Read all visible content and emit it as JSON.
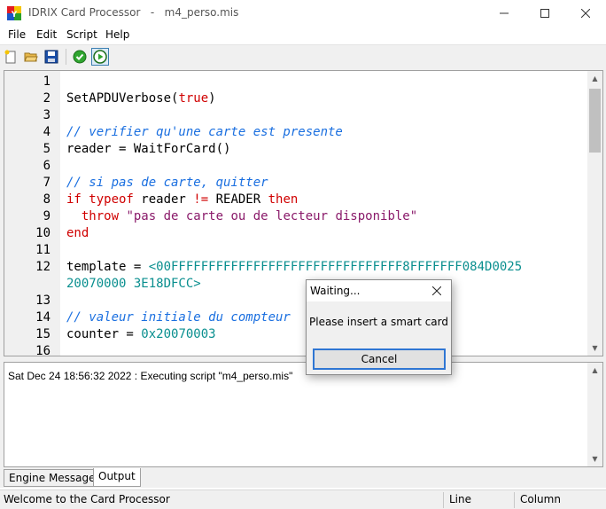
{
  "window": {
    "app_name": "IDRIX Card Processor",
    "separator": "-",
    "file_name": "m4_perso.mis"
  },
  "menu": [
    "File",
    "Edit",
    "Script",
    "Help"
  ],
  "toolbar": {
    "icons": [
      "new-file-icon",
      "open-folder-icon",
      "save-icon",
      "check-icon",
      "run-icon"
    ]
  },
  "editor": {
    "lines": [
      {
        "n": "1",
        "segments": []
      },
      {
        "n": "2",
        "segments": [
          {
            "t": "SetAPDUVerbose(",
            "c": "plain"
          },
          {
            "t": "true",
            "c": "kw"
          },
          {
            "t": ")",
            "c": "plain"
          }
        ]
      },
      {
        "n": "3",
        "segments": []
      },
      {
        "n": "4",
        "segments": [
          {
            "t": "// verifier qu'une carte est presente",
            "c": "cm"
          }
        ]
      },
      {
        "n": "5",
        "segments": [
          {
            "t": "reader = WaitForCard()",
            "c": "plain"
          }
        ]
      },
      {
        "n": "6",
        "segments": []
      },
      {
        "n": "7",
        "segments": [
          {
            "t": "// si pas de carte, quitter",
            "c": "cm"
          }
        ]
      },
      {
        "n": "8",
        "segments": [
          {
            "t": "if typeof",
            "c": "kw"
          },
          {
            "t": " reader ",
            "c": "plain"
          },
          {
            "t": "!=",
            "c": "kw"
          },
          {
            "t": " READER ",
            "c": "plain"
          },
          {
            "t": "then",
            "c": "kw"
          }
        ]
      },
      {
        "n": "9",
        "segments": [
          {
            "t": "  throw ",
            "c": "kw"
          },
          {
            "t": "\"pas de carte ou de lecteur disponible\"",
            "c": "str"
          }
        ]
      },
      {
        "n": "10",
        "segments": [
          {
            "t": "end",
            "c": "kw"
          }
        ]
      },
      {
        "n": "11",
        "segments": []
      },
      {
        "n": "12",
        "segments": [
          {
            "t": "template = ",
            "c": "plain"
          },
          {
            "t": "<00FFFFFFFFFFFFFFFFFFFFFFFFFFFFFFF8FFFFFFF084D0025",
            "c": "num"
          }
        ]
      },
      {
        "n": "",
        "segments": [
          {
            "t": "20070000 3E18DFCC>",
            "c": "num"
          }
        ]
      },
      {
        "n": "13",
        "segments": []
      },
      {
        "n": "14",
        "segments": [
          {
            "t": "// valeur initiale du compteur",
            "c": "cm"
          }
        ]
      },
      {
        "n": "15",
        "segments": [
          {
            "t": "counter = ",
            "c": "plain"
          },
          {
            "t": "0x20070003",
            "c": "num"
          }
        ]
      },
      {
        "n": "16",
        "segments": []
      }
    ]
  },
  "output": {
    "lines": [
      "Sat Dec 24 18:56:32 2022 : Executing script \"m4_perso.mis\""
    ]
  },
  "tabs": [
    {
      "label": "Engine Messages",
      "selected": false
    },
    {
      "label": "Output",
      "selected": true
    }
  ],
  "status": {
    "message": "Welcome to the Card Processor",
    "line_label": "Line",
    "column_label": "Column"
  },
  "dialog": {
    "title": "Waiting...",
    "message": "Please insert a smart card",
    "button": "Cancel"
  },
  "colors": {
    "keyword": "#d00000",
    "comment": "#1a6fe0",
    "string": "#8a1a6a",
    "number": "#0a8f8f",
    "dialog_button_border": "#2f76d3"
  }
}
